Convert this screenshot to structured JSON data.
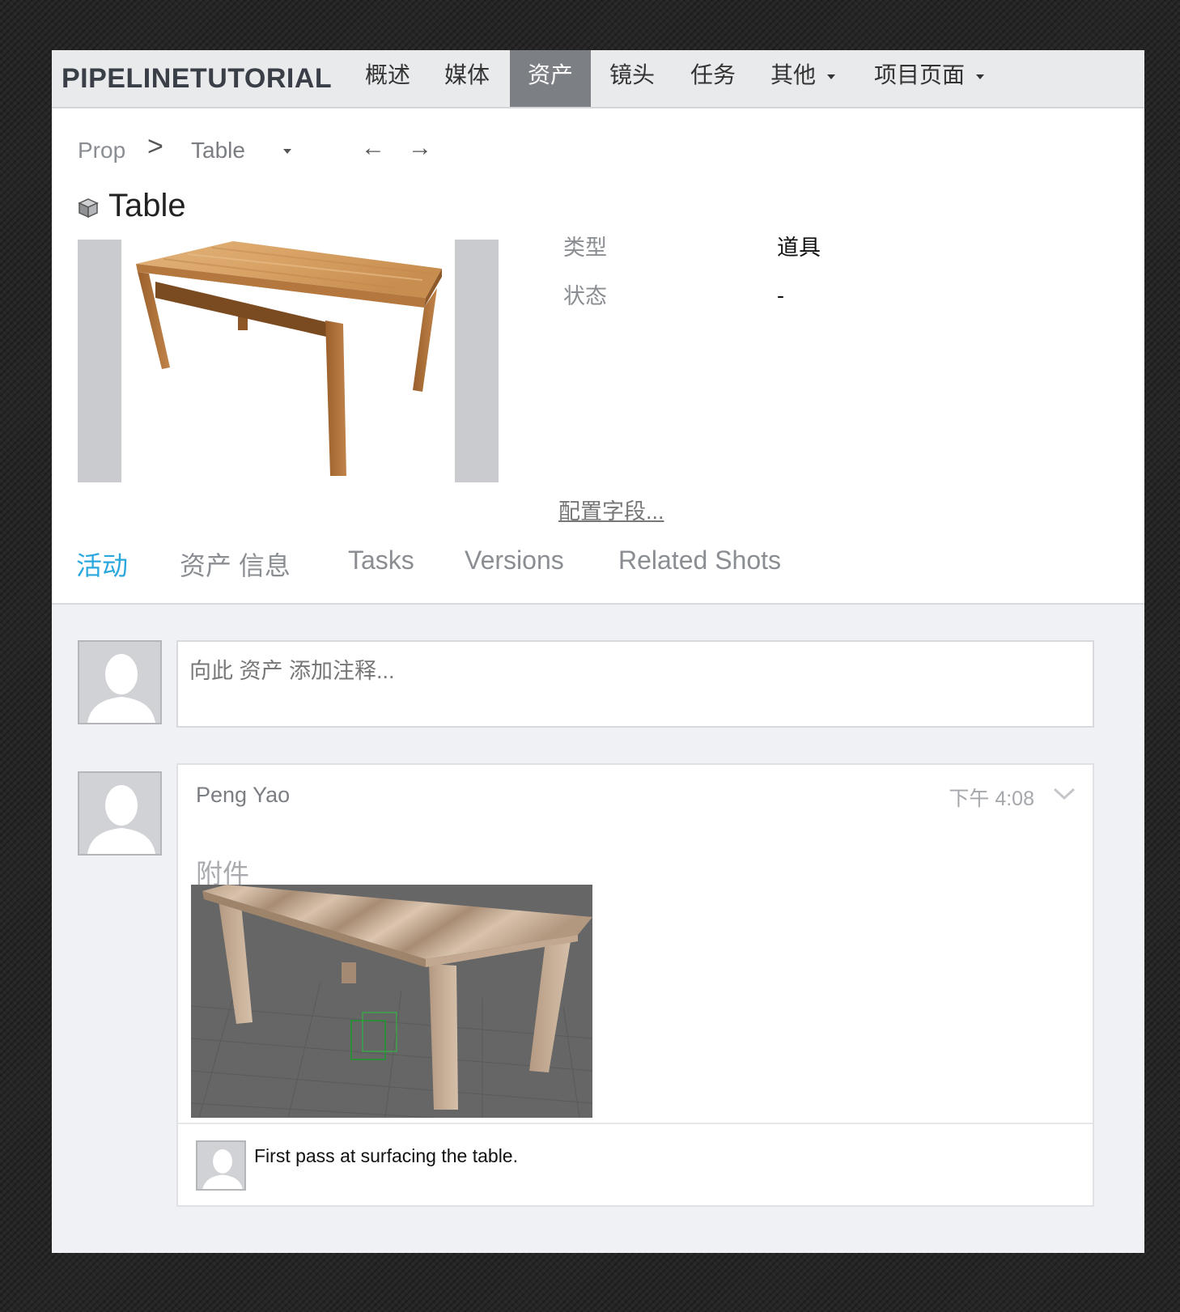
{
  "nav": {
    "brand": "PIPELINETUTORIAL",
    "items": [
      {
        "label": "概述"
      },
      {
        "label": "媒体"
      },
      {
        "label": "资产",
        "active": true
      },
      {
        "label": "镜头"
      },
      {
        "label": "任务"
      },
      {
        "label": "其他",
        "dropdown": true
      },
      {
        "label": "项目页面",
        "dropdown": true
      }
    ]
  },
  "breadcrumb": {
    "parent": "Prop",
    "separator": ">",
    "current": "Table",
    "prev_icon": "arrow-left-icon",
    "next_icon": "arrow-right-icon"
  },
  "asset": {
    "icon": "cube-icon",
    "title": "Table",
    "thumbnail": "wooden-table-photo"
  },
  "fields": [
    {
      "label": "类型",
      "value": "道具"
    },
    {
      "label": "状态",
      "value": "-"
    }
  ],
  "config_link": "配置字段...",
  "tabs": [
    {
      "label": "活动",
      "active": true
    },
    {
      "label": "资产 信息"
    },
    {
      "label": "Tasks"
    },
    {
      "label": "Versions"
    },
    {
      "label": "Related Shots"
    }
  ],
  "note_form": {
    "placeholder": "向此 资产 添加注释..."
  },
  "activity": {
    "author": "Peng Yao",
    "time": "下午 4:08",
    "attachments_label": "附件",
    "attachment": "table-3d-render",
    "reply_text": "First pass at surfacing the table."
  },
  "colors": {
    "accent": "#2aa8dd",
    "nav_active": "#7c7f84",
    "nav_bg": "#e9eaec"
  }
}
